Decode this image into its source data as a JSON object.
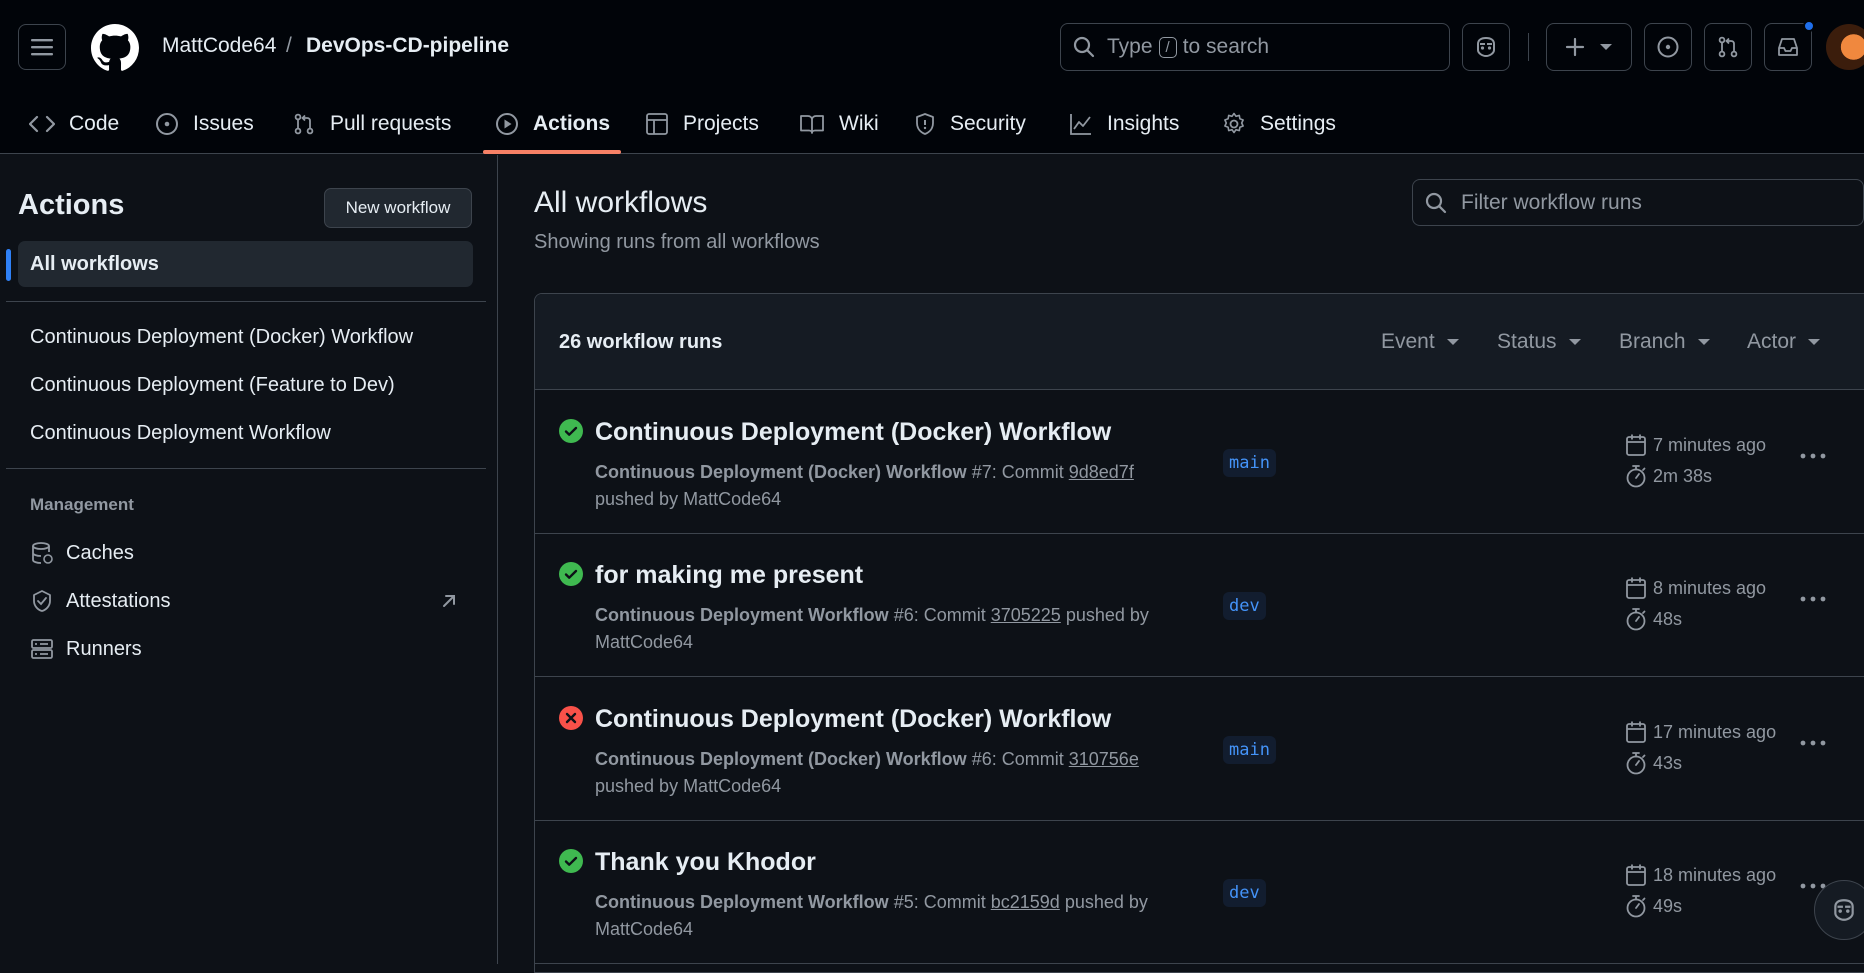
{
  "header": {
    "owner": "MattCode64",
    "separator": "/",
    "repo": "DevOps-CD-pipeline",
    "search_prefix": "Type",
    "search_key": "/",
    "search_suffix": "to search"
  },
  "repo_nav": {
    "tabs": [
      {
        "label": "Code"
      },
      {
        "label": "Issues"
      },
      {
        "label": "Pull requests"
      },
      {
        "label": "Actions"
      },
      {
        "label": "Projects"
      },
      {
        "label": "Wiki"
      },
      {
        "label": "Security"
      },
      {
        "label": "Insights"
      },
      {
        "label": "Settings"
      }
    ]
  },
  "sidebar": {
    "title": "Actions",
    "new_workflow_label": "New workflow",
    "all_workflows_label": "All workflows",
    "workflows": [
      {
        "label": "Continuous Deployment (Docker) Workflow"
      },
      {
        "label": "Continuous Deployment (Feature to Dev)"
      },
      {
        "label": "Continuous Deployment Workflow"
      }
    ],
    "management_heading": "Management",
    "management_items": [
      {
        "label": "Caches"
      },
      {
        "label": "Attestations"
      },
      {
        "label": "Runners"
      }
    ]
  },
  "main": {
    "title": "All workflows",
    "subtitle": "Showing runs from all workflows",
    "filter_placeholder": "Filter workflow runs",
    "runs_count": "26 workflow runs",
    "filters": {
      "event": "Event",
      "status": "Status",
      "branch": "Branch",
      "actor": "Actor"
    },
    "runs": [
      {
        "status": "success",
        "title": "Continuous Deployment (Docker) Workflow",
        "workflow": "Continuous Deployment (Docker) Workflow",
        "run_number": "#7: Commit",
        "sha": "9d8ed7f",
        "pushed_by": "pushed by MattCode64",
        "branch": "main",
        "when": "7 minutes ago",
        "duration": "2m 38s"
      },
      {
        "status": "success",
        "title": "for making me present",
        "workflow": "Continuous Deployment Workflow",
        "run_number": "#6: Commit",
        "sha": "3705225",
        "pushed_by": "pushed by MattCode64",
        "branch": "dev",
        "when": "8 minutes ago",
        "duration": "48s"
      },
      {
        "status": "failure",
        "title": "Continuous Deployment (Docker) Workflow",
        "workflow": "Continuous Deployment (Docker) Workflow",
        "run_number": "#6: Commit",
        "sha": "310756e",
        "pushed_by": "pushed by MattCode64",
        "branch": "main",
        "when": "17 minutes ago",
        "duration": "43s"
      },
      {
        "status": "success",
        "title": "Thank you Khodor",
        "workflow": "Continuous Deployment Workflow",
        "run_number": "#5: Commit",
        "sha": "bc2159d",
        "pushed_by": "pushed by MattCode64",
        "branch": "dev",
        "when": "18 minutes ago",
        "duration": "49s"
      }
    ]
  },
  "colors": {
    "success": "#3fb950",
    "failure": "#f85149",
    "accent": "#f78166",
    "link": "#4493f8"
  }
}
